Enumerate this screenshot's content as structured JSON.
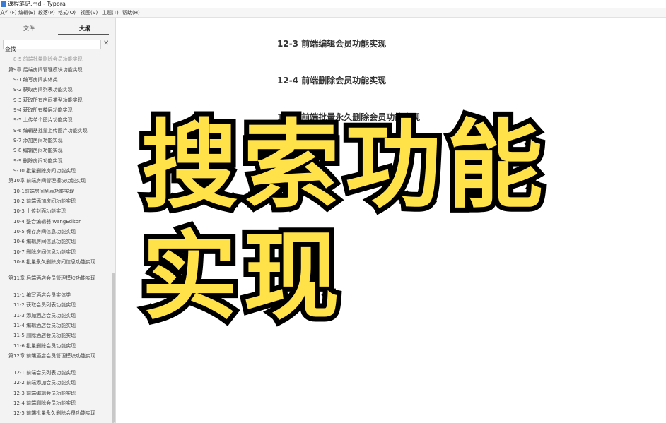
{
  "window": {
    "title": "课程笔记.md - Typora"
  },
  "menu": [
    "文件(F)",
    "编辑(E)",
    "段落(P)",
    "格式(O)",
    "视图(V)",
    "主题(T)",
    "帮助(H)"
  ],
  "sidebar": {
    "tabs": [
      {
        "label": "文件"
      },
      {
        "label": "大纲"
      }
    ],
    "search_value": "查找",
    "outline": [
      "8-5 前端批量删除会员功能实现",
      "第9章 后端房间管理模块功能实现",
      "9-1 编写房间实体类",
      "9-2 获取房间列表功能实现",
      "9-3 获取所有房间类型功能实现",
      "9-4 获取所有楼层功能实现",
      "9-5 上传单个图片功能实现",
      "9-6 编辑器批量上传图片功能实现",
      "9-7 添加房间功能实现",
      "9-8 编辑房间功能实现",
      "9-9 删除房间功能实现",
      "9-10 批量删除房间功能实现",
      "第10章 前端房间管理模块功能实现",
      "10-1前端房间列表功能实现",
      "10-2 前端添加房间功能实现",
      "10-3 上传封面功能实现",
      "10-4 整合编辑器 wangEditor",
      "10-5 保存房间信息功能实现",
      "10-6 编辑房间信息功能实现",
      "10-7 删除房间信息功能实现",
      "10-8 批量永久删除房间信息功能实现",
      "第11章 后端酒店会员管理模块功能实现",
      "11-1 编写酒店会员实体类",
      "11-2 获取会员列表功能实现",
      "11-3 添加酒店会员功能实现",
      "11-4 编辑酒店会员功能实现",
      "11-5 删除酒店会员功能实现",
      "11-6 批量删除会员功能实现",
      "第12章 前端酒店会员管理模块功能实现",
      "12-1 前端会员列表功能实现",
      "12-2 前端添加会员功能实现",
      "12-3 前端编辑会员功能实现",
      "12-4 前端删除会员功能实现",
      "12-5 前端批量永久删除会员功能实现"
    ]
  },
  "document": {
    "headings": [
      "12-3 前端编辑会员功能实现",
      "12-4 前端删除会员功能实现",
      "12-5 前端批量永久删除会员功能实现"
    ]
  },
  "caption": {
    "line1": "搜索功能",
    "line2": "实现"
  },
  "colors": {
    "caption_fill": "#ffe14a",
    "caption_stroke": "#000000"
  }
}
